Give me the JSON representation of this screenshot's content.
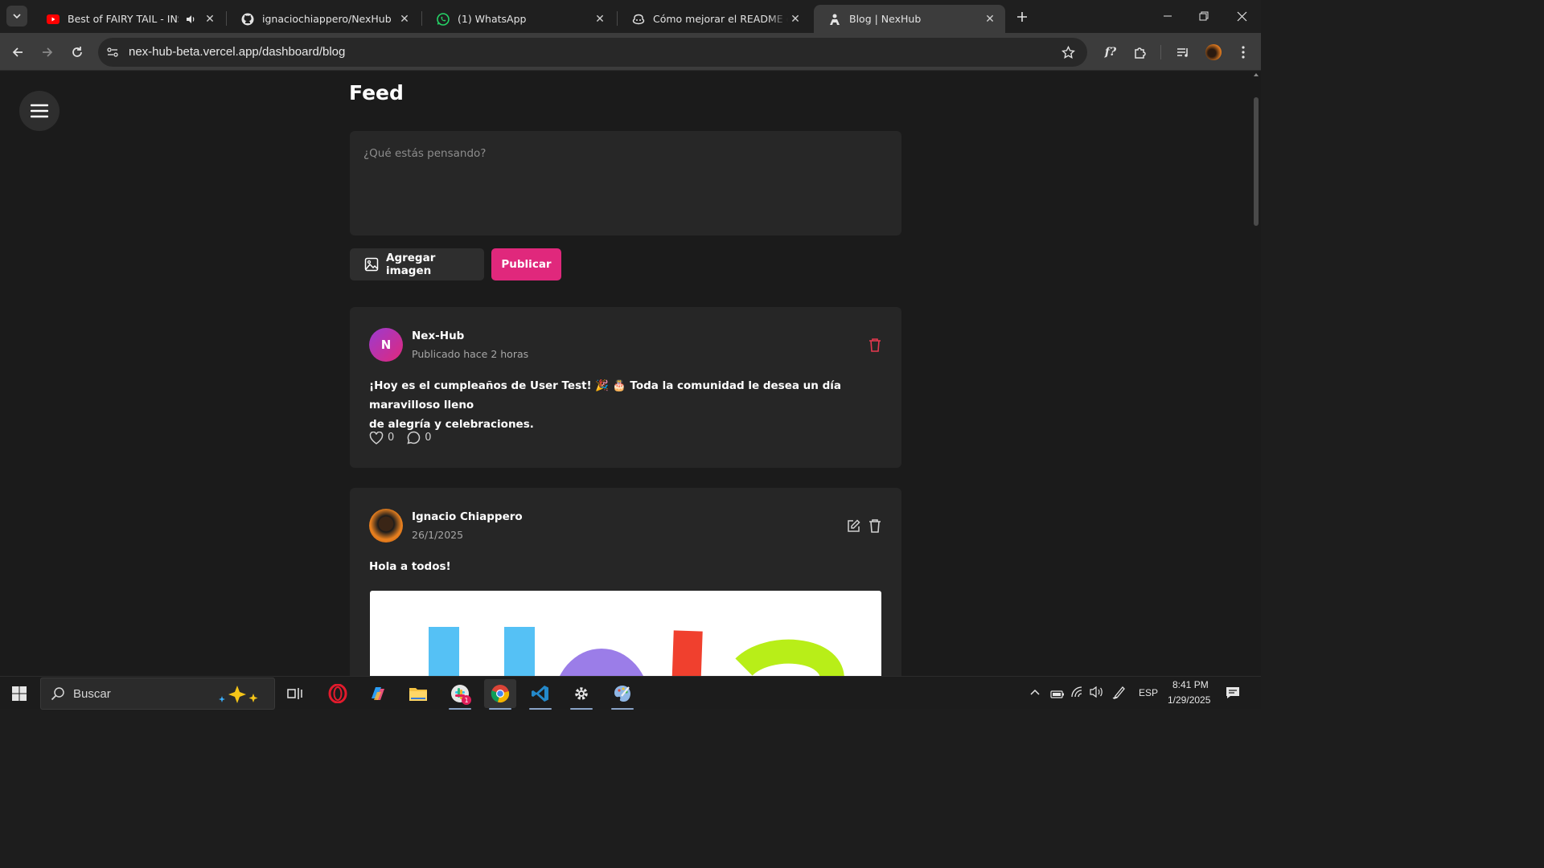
{
  "browser": {
    "tabs": [
      {
        "title": "Best of FAIRY TAIL - INSANE",
        "favicon": "youtube-icon",
        "audio": true,
        "active": false
      },
      {
        "title": "ignaciochiappero/NexHub",
        "favicon": "github-icon",
        "audio": false,
        "active": false
      },
      {
        "title": "(1) WhatsApp",
        "favicon": "whatsapp-icon",
        "audio": false,
        "active": false
      },
      {
        "title": "Cómo mejorar el README de u",
        "favicon": "copilot-icon",
        "audio": false,
        "active": false
      },
      {
        "title": "Blog | NexHub",
        "favicon": "nexhub-icon",
        "audio": false,
        "active": true
      }
    ],
    "url": "nex-hub-beta.vercel.app/dashboard/blog"
  },
  "page": {
    "title": "Feed",
    "composer": {
      "placeholder": "¿Qué estás pensando?"
    },
    "add_image_label": "Agregar imagen",
    "publish_label": "Publicar",
    "posts": [
      {
        "avatar_letter": "N",
        "author": "Nex-Hub",
        "meta": "Publicado hace 2 horas",
        "text_line1": "¡Hoy es el cumpleaños de User Test! 🎉 🎂 Toda la comunidad le desea un día maravilloso lleno",
        "text_line2": "de alegría y celebraciones.",
        "likes": "0",
        "comments": "0"
      },
      {
        "author": "Ignacio Chiappero",
        "meta": "26/1/2025",
        "text": "Hola a todos!"
      }
    ]
  },
  "taskbar": {
    "search_placeholder": "Buscar",
    "language": "ESP",
    "time": "8:41 PM",
    "date": "1/29/2025"
  },
  "colors": {
    "accent": "#e0287c",
    "background": "#1b1b1b",
    "card": "#262626"
  }
}
